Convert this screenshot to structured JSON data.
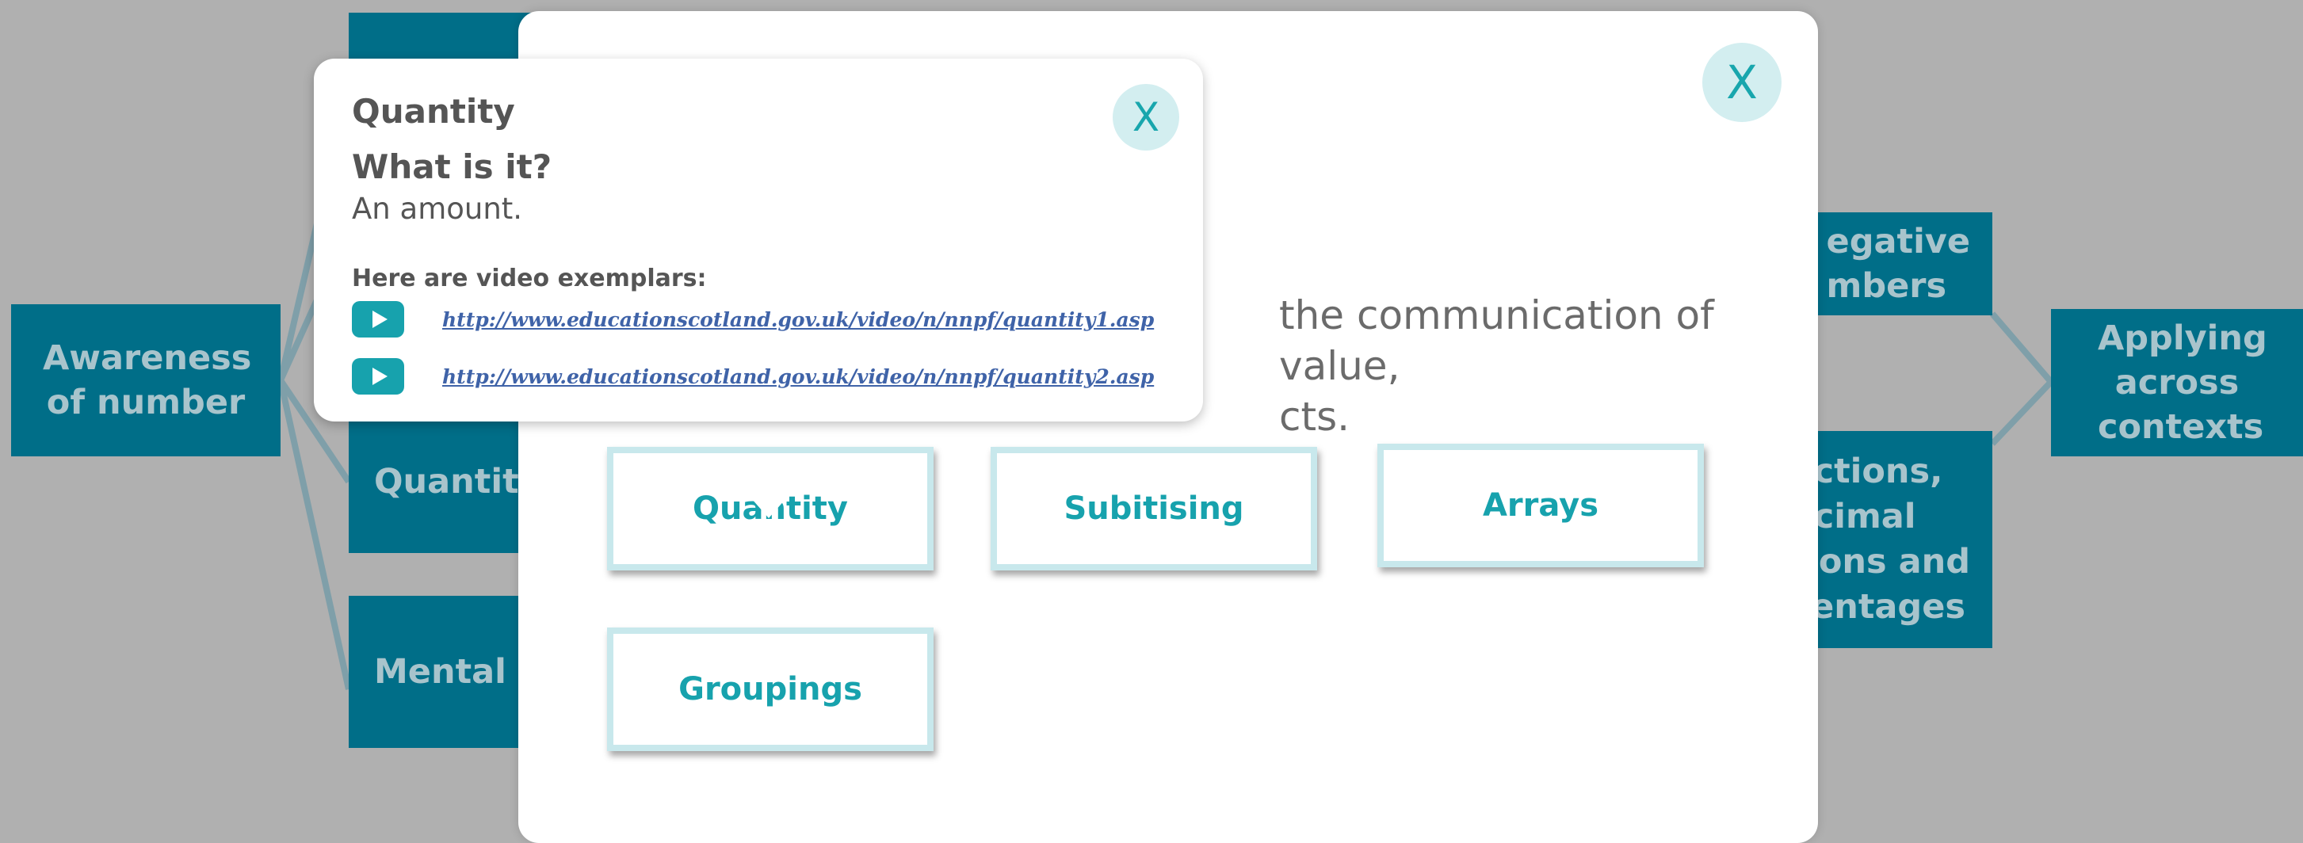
{
  "background_map": {
    "node_color": "#006e88",
    "line_color": "#7f9fa9",
    "awareness": "Awareness of number",
    "quantity_clipped": "Quantit",
    "mental_clipped": "Mental ag",
    "negative_line1": "egative",
    "negative_line2": "mbers",
    "fractions_line1": "actions,",
    "fractions_line2": "ecimal",
    "fractions_line3": "tions and",
    "fractions_line4": "centages",
    "applying": "Applying across contexts"
  },
  "modal": {
    "close_label": "X",
    "description_line1": "the communication of value,",
    "description_line2": "cts.",
    "tiles": [
      {
        "label": "Quantity"
      },
      {
        "label": "Subitising"
      },
      {
        "label": "Arrays"
      },
      {
        "label": "Groupings"
      }
    ]
  },
  "popup": {
    "close_label": "X",
    "title": "Quantity",
    "heading": "What is it?",
    "definition": "An amount.",
    "video_label": "Here are video exemplars:",
    "videos": [
      {
        "icon": "play-icon",
        "url": "http://www.educationscotland.gov.uk/video/n/nnpf/quantity1.asp"
      },
      {
        "icon": "play-icon",
        "url": "http://www.educationscotland.gov.uk/video/n/nnpf/quantity2.asp"
      }
    ]
  },
  "colors": {
    "accent": "#17a2ad",
    "close_bg": "#d3eef0",
    "link": "#3f63a8",
    "text": "#555555"
  }
}
